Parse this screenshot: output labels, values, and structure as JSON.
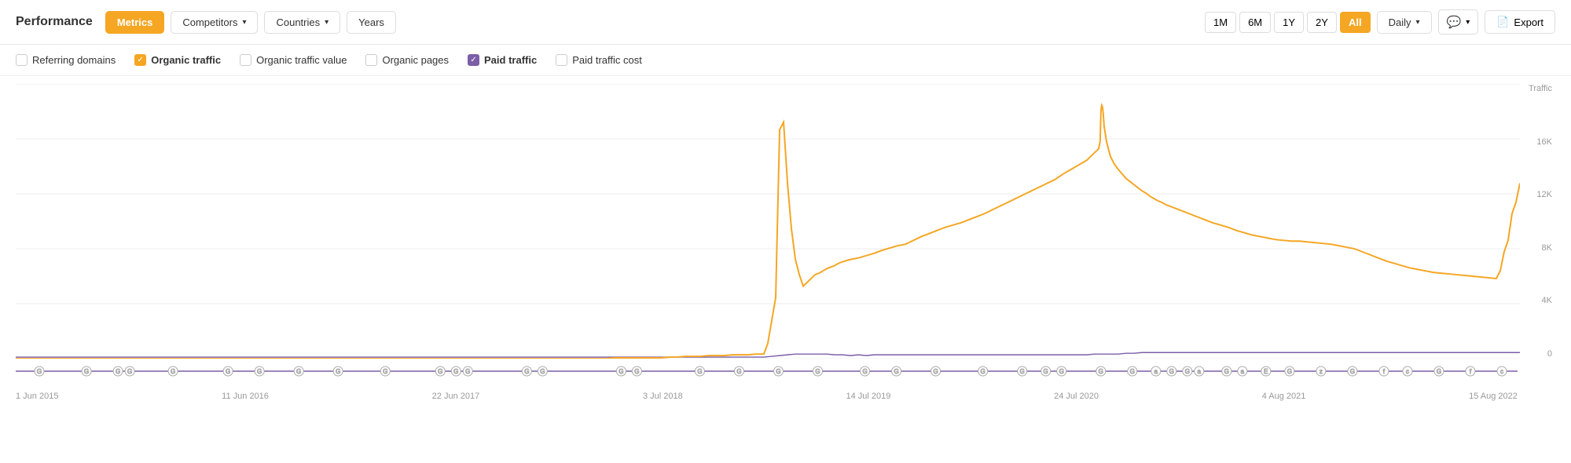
{
  "header": {
    "title": "Performance",
    "buttons": {
      "metrics": "Metrics",
      "competitors": "Competitors",
      "countries": "Countries",
      "years": "Years"
    },
    "timeRanges": [
      "1M",
      "6M",
      "1Y",
      "2Y",
      "All"
    ],
    "activeTimeRange": "All",
    "intervalLabel": "Daily",
    "commentLabel": "",
    "exportLabel": "Export"
  },
  "metrics": [
    {
      "id": "referring-domains",
      "label": "Referring domains",
      "checked": false,
      "bold": false,
      "color": "none"
    },
    {
      "id": "organic-traffic",
      "label": "Organic traffic",
      "checked": true,
      "bold": true,
      "color": "orange"
    },
    {
      "id": "organic-traffic-value",
      "label": "Organic traffic value",
      "checked": false,
      "bold": false,
      "color": "none"
    },
    {
      "id": "organic-pages",
      "label": "Organic pages",
      "checked": false,
      "bold": false,
      "color": "none"
    },
    {
      "id": "paid-traffic",
      "label": "Paid traffic",
      "checked": true,
      "bold": true,
      "color": "purple"
    },
    {
      "id": "paid-traffic-cost",
      "label": "Paid traffic cost",
      "checked": false,
      "bold": false,
      "color": "none"
    }
  ],
  "chart": {
    "yAxisLabels": [
      "Traffic",
      "16K",
      "12K",
      "8K",
      "4K",
      "0"
    ],
    "xAxisLabels": [
      "1 Jun 2015",
      "11 Jun 2016",
      "22 Jun 2017",
      "3 Jul 2018",
      "14 Jul 2019",
      "24 Jul 2020",
      "4 Aug 2021",
      "15 Aug 2022"
    ],
    "accentColor": "#f5a623",
    "purpleColor": "#7b5ea7"
  }
}
